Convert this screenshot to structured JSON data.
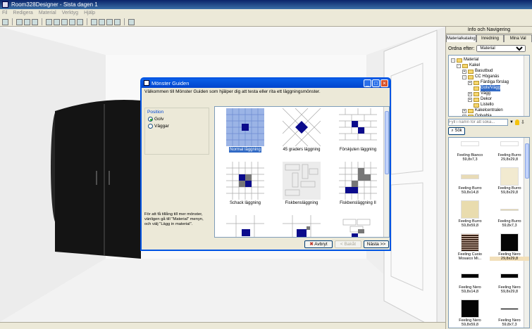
{
  "window": {
    "title": "Room328Designer - Sista dagen 1"
  },
  "menu": [
    "Fil",
    "Redigera",
    "Material",
    "Verktyg",
    "Hjälp"
  ],
  "panel": {
    "title": "Info och Navigering",
    "tabs": [
      "Materialkatalog",
      "Inredning",
      "Mina Val"
    ],
    "sort_label": "Ordna efter:",
    "sort_value": "Material",
    "tree": [
      {
        "label": "Material",
        "level": 0,
        "expander": "-"
      },
      {
        "label": "Kakel",
        "level": 1,
        "expander": "-"
      },
      {
        "label": "Basutbud",
        "level": 2,
        "expander": "+"
      },
      {
        "label": "CC Höganäs",
        "level": 2,
        "expander": "-"
      },
      {
        "label": "Färdiga förslag",
        "level": 3,
        "expander": "+"
      },
      {
        "label": "Golv/Vägg",
        "level": 3,
        "expander": "",
        "selected": true
      },
      {
        "label": "Vägg",
        "level": 3,
        "expander": "+"
      },
      {
        "label": "Dekor",
        "level": 3,
        "expander": "+"
      },
      {
        "label": "Listello",
        "level": 3,
        "expander": ""
      },
      {
        "label": "Kakelcentralen",
        "level": 2,
        "expander": "+"
      },
      {
        "label": "Golvabia",
        "level": 2,
        "expander": "+"
      }
    ],
    "search_placeholder": "Fyll i namn för att söka...",
    "search_button": "Sök",
    "materials": [
      {
        "name": "Feeling Bianco",
        "size": "59,8x7,3",
        "color": "#ffffff",
        "shape": "strip"
      },
      {
        "name": "Feeling Burro",
        "size": "29,8x29,8",
        "color": "#ffffff",
        "shape": "strip"
      },
      {
        "name": "Feeling Burro",
        "size": "59,8x14,8",
        "color": "#e8dbb6",
        "shape": "strip"
      },
      {
        "name": "Feeling Burro",
        "size": "59,8x29,8",
        "color": "#f2ead0",
        "shape": "square"
      },
      {
        "name": "Feeling Burro",
        "size": "59,8x59,8",
        "color": "#e9dcae",
        "shape": "square"
      },
      {
        "name": "Feeling Burro",
        "size": "59,8x7,3",
        "color": "#e3d4a6",
        "shape": "thin"
      },
      {
        "name": "Feeling Cuoio",
        "size": "Mosaico Mi...",
        "color": "#3b2418",
        "shape": "stripes"
      },
      {
        "name": "Feeling Nero",
        "size": "29,8x29,8",
        "color": "#050505",
        "shape": "square",
        "highlight": true
      },
      {
        "name": "Feeling Nero",
        "size": "59,8x14,8",
        "color": "#050505",
        "shape": "strip"
      },
      {
        "name": "Feeling Nero",
        "size": "59,8x29,8",
        "color": "#050505",
        "shape": "strip"
      },
      {
        "name": "Feeling Nero",
        "size": "59,8x59,8",
        "color": "#050505",
        "shape": "square"
      },
      {
        "name": "Feeling Nero",
        "size": "59,8x7,3",
        "color": "#050505",
        "shape": "thin"
      }
    ]
  },
  "dialog": {
    "title": "Mönster Guiden",
    "intro": "Välkommen till Mönster Guiden som hjälper dig att testa eller rita ett läggningsmönster.",
    "position_label": "Position",
    "options": [
      {
        "label": "Golv",
        "checked": true
      },
      {
        "label": "Väggar",
        "checked": false
      }
    ],
    "hint": "För att få tillång till mer mönster, vänligen gå till \"Material\" menyn, och välj \"Lägg in material\".",
    "patterns": [
      {
        "label": "Normal läggning",
        "selected": true
      },
      {
        "label": "45 graders läggning",
        "selected": false
      },
      {
        "label": "Förskjuten läggning",
        "selected": false
      },
      {
        "label": "Schack läggning",
        "selected": false
      },
      {
        "label": "Fiskbensläggning",
        "selected": false
      },
      {
        "label": "Fiskbensläggning II",
        "selected": false
      },
      {
        "label": "",
        "selected": false
      },
      {
        "label": "",
        "selected": false
      },
      {
        "label": "",
        "selected": false
      }
    ],
    "buttons": {
      "cancel": "Avbryt",
      "back": "< Bakåt",
      "next": "Nästa >>"
    }
  },
  "colors": {
    "accent": "#0054e3",
    "tile_blue": "#0b0b8c",
    "tree_select": "#316ac5"
  }
}
